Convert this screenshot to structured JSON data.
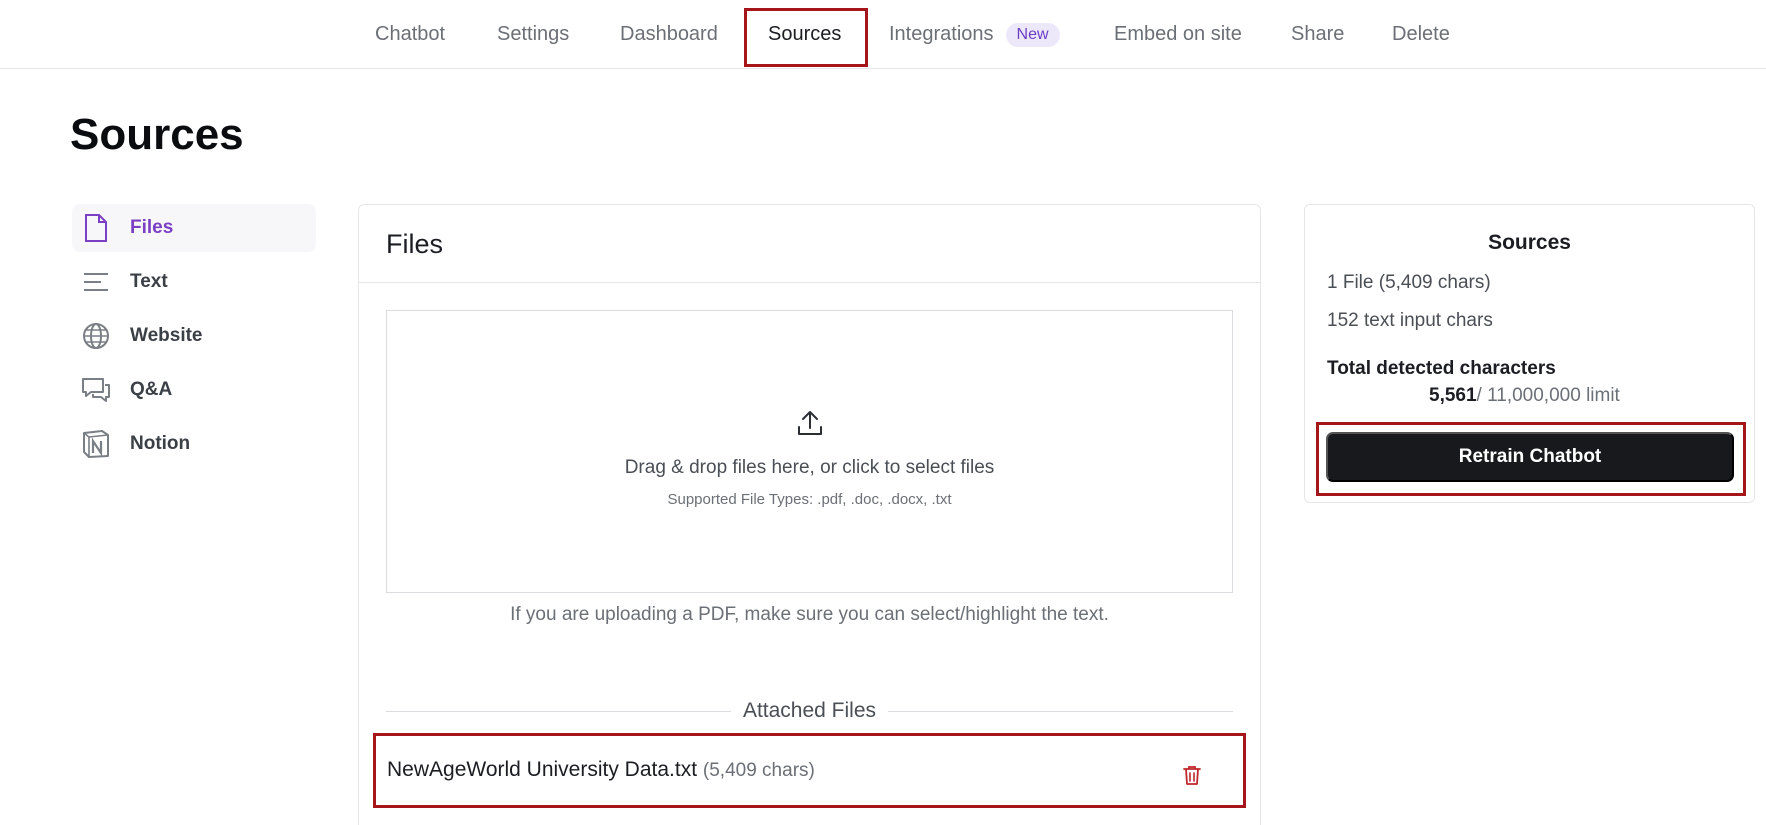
{
  "nav": {
    "tabs": [
      {
        "label": "Chatbot"
      },
      {
        "label": "Settings"
      },
      {
        "label": "Dashboard"
      },
      {
        "label": "Sources"
      },
      {
        "label": "Integrations",
        "badge": "New"
      },
      {
        "label": "Embed on site"
      },
      {
        "label": "Share"
      },
      {
        "label": "Delete"
      }
    ],
    "active": "Sources"
  },
  "page": {
    "title": "Sources"
  },
  "sidebar": {
    "items": [
      {
        "label": "Files",
        "icon": "file-icon"
      },
      {
        "label": "Text",
        "icon": "text-lines-icon"
      },
      {
        "label": "Website",
        "icon": "globe-icon"
      },
      {
        "label": "Q&A",
        "icon": "chat-bubbles-icon"
      },
      {
        "label": "Notion",
        "icon": "notion-icon"
      }
    ],
    "active": "Files"
  },
  "files_panel": {
    "title": "Files",
    "drop_text": "Drag & drop files here, or click to select files",
    "supported_types": "Supported File Types: .pdf, .doc, .docx, .txt",
    "pdf_note": "If you are uploading a PDF, make sure you can select/highlight the text.",
    "attached_label": "Attached Files",
    "attached": [
      {
        "name": "NewAgeWorld University Data.txt",
        "chars": "(5,409 chars)"
      }
    ]
  },
  "summary": {
    "title": "Sources",
    "files_line": "1 File (5,409 chars)",
    "text_line": "152 text input chars",
    "total_label": "Total detected characters",
    "total_value": "5,561",
    "limit_text": "/ 11,000,000 limit",
    "retrain_label": "Retrain Chatbot"
  },
  "colors": {
    "accent": "#7b3fc4",
    "highlight": "#a4161a",
    "button": "#18191d"
  }
}
